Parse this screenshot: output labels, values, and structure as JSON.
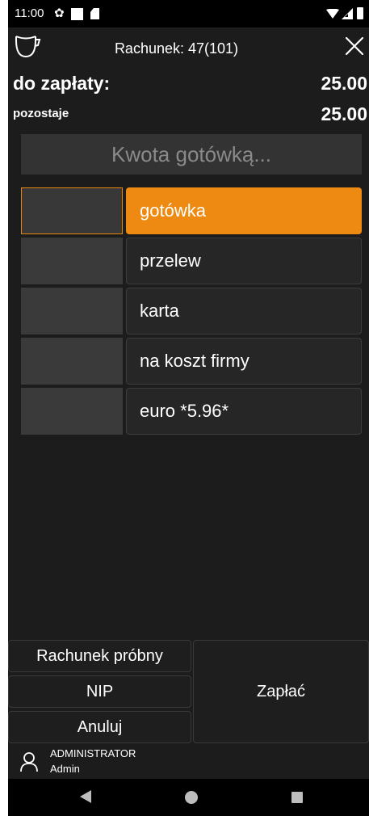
{
  "status_bar": {
    "time": "11:00",
    "icons": [
      "gear-icon",
      "square-icon",
      "sd-card-icon",
      "wifi-icon",
      "signal-icon",
      "battery-icon"
    ]
  },
  "header": {
    "title": "Rachunek: 47(101)",
    "left_icon": "cup-icon",
    "right_icon": "close-icon"
  },
  "totals": {
    "due_label": "do zapłaty:",
    "due_value": "25.00",
    "remaining_label": "pozostaje",
    "remaining_value": "25.00"
  },
  "cash_input": {
    "placeholder": "Kwota gotówką..."
  },
  "payment_methods": [
    {
      "label": "gotówka",
      "active": true
    },
    {
      "label": "przelew",
      "active": false
    },
    {
      "label": "karta",
      "active": false
    },
    {
      "label": "na koszt firmy",
      "active": false
    },
    {
      "label": "euro *5.96*",
      "active": false
    }
  ],
  "actions": {
    "test_bill": "Rachunek próbny",
    "nip": "NIP",
    "cancel": "Anuluj",
    "pay": "Zapłać"
  },
  "user": {
    "role": "ADMINISTRATOR",
    "name": "Admin",
    "icon": "user-icon"
  },
  "colors": {
    "accent": "#ee8a12",
    "background": "#1c1c1c",
    "panel": "#333333"
  }
}
